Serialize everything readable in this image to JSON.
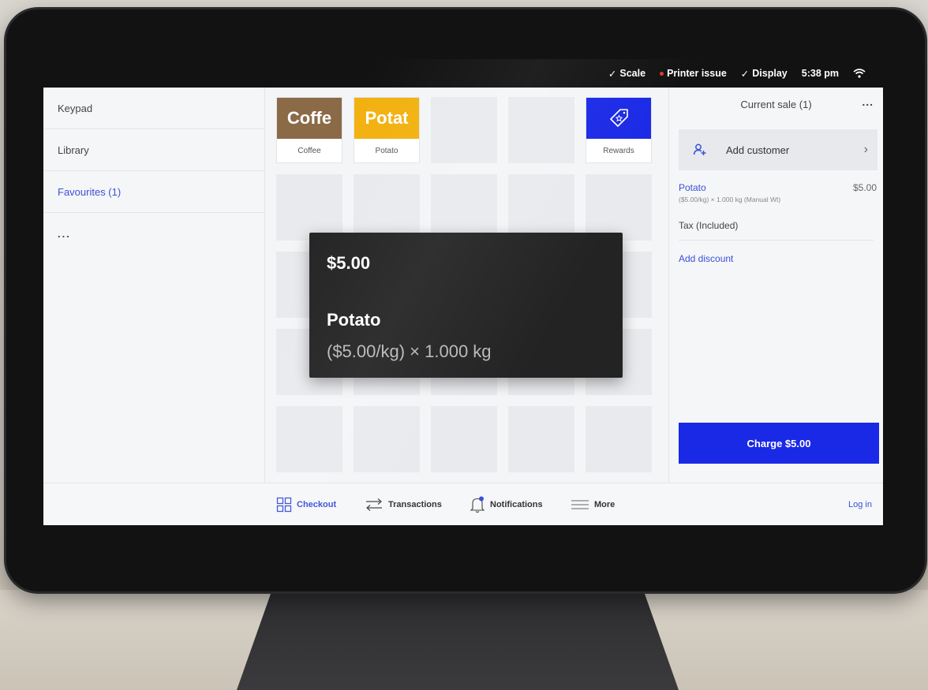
{
  "status_bar": {
    "scale": "Scale",
    "printer": "Printer issue",
    "display": "Display",
    "time": "5:38 pm"
  },
  "left_nav": {
    "items": [
      {
        "label": "Keypad"
      },
      {
        "label": "Library"
      },
      {
        "label": "Favourites (1)"
      },
      {
        "label": "..."
      }
    ]
  },
  "tiles": {
    "coffee": {
      "abbrev": "Coffe",
      "label": "Coffee",
      "color": "#8b6a48"
    },
    "potato": {
      "abbrev": "Potat",
      "label": "Potato",
      "color": "#f2b10f"
    },
    "rewards": {
      "label": "Rewards",
      "color": "#1a29e6",
      "icon": "tag-star-icon"
    }
  },
  "bottom_nav": {
    "checkout": "Checkout",
    "transactions": "Transactions",
    "notifications": "Notifications",
    "more": "More",
    "login": "Log in"
  },
  "sale": {
    "title": "Current sale (1)",
    "menu": "...",
    "add_customer": "Add customer",
    "line_item": {
      "name": "Potato",
      "price": "$5.00",
      "detail": "($5.00/kg) × 1.000 kg (Manual Wt)"
    },
    "tax": "Tax (Included)",
    "add_discount": "Add discount",
    "charge": "Charge $5.00"
  },
  "popup": {
    "price": "$5.00",
    "name": "Potato",
    "detail": "($5.00/kg) × 1.000 kg"
  },
  "colors": {
    "accent": "#3b4fd8",
    "charge_button": "#1a29e6",
    "status_dot": "#e0392f"
  }
}
